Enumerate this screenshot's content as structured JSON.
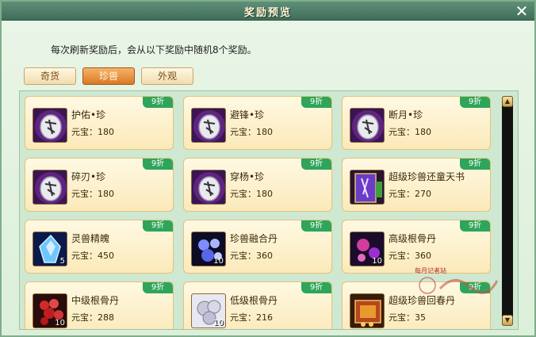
{
  "window": {
    "title": "奖励预览"
  },
  "intro_text": "每次刷新奖励后，会从以下奖励中随机8个奖励。",
  "tabs": [
    {
      "label": "奇货",
      "active": false
    },
    {
      "label": "珍兽",
      "active": true
    },
    {
      "label": "外观",
      "active": false
    }
  ],
  "items": [
    {
      "name": "护佑•珍",
      "price": "元宝：180",
      "discount": "9折",
      "icon": "skill-stone-icon",
      "qty": ""
    },
    {
      "name": "避锋•珍",
      "price": "元宝：180",
      "discount": "9折",
      "icon": "skill-stone-icon",
      "qty": ""
    },
    {
      "name": "断月•珍",
      "price": "元宝：180",
      "discount": "9折",
      "icon": "skill-stone-icon",
      "qty": ""
    },
    {
      "name": "碎刃•珍",
      "price": "元宝：180",
      "discount": "9折",
      "icon": "skill-stone-icon",
      "qty": ""
    },
    {
      "name": "穿杨•珍",
      "price": "元宝：180",
      "discount": "9折",
      "icon": "skill-stone-icon",
      "qty": ""
    },
    {
      "name": "超级珍兽还童天书",
      "price": "元宝：270",
      "discount": "9折",
      "icon": "scroll-book-icon",
      "qty": ""
    },
    {
      "name": "灵兽精魄",
      "price": "元宝：450",
      "discount": "9折",
      "icon": "crystal-soul-icon",
      "qty": "5"
    },
    {
      "name": "珍兽融合丹",
      "price": "元宝：360",
      "discount": "9折",
      "icon": "fusion-pill-icon",
      "qty": "10"
    },
    {
      "name": "高级根骨丹",
      "price": "元宝：360",
      "discount": "9折",
      "icon": "bone-pill-icon",
      "qty": "10"
    },
    {
      "name": "中级根骨丹",
      "price": "元宝：288",
      "discount": "9折",
      "icon": "berry-pill-icon",
      "qty": "10"
    },
    {
      "name": "低级根骨丹",
      "price": "元宝：216",
      "discount": "9折",
      "icon": "pearl-pill-icon",
      "qty": "10"
    },
    {
      "name": "超级珍兽回春丹",
      "price": "元宝：35",
      "discount": "9折",
      "icon": "treasure-chest-icon",
      "qty": ""
    }
  ],
  "watermark": {
    "text": "每月记者站"
  },
  "colors": {
    "discount_badge": "#2ea55a",
    "active_tab": "#d97a25",
    "titlebar": "#3f6e5a"
  }
}
